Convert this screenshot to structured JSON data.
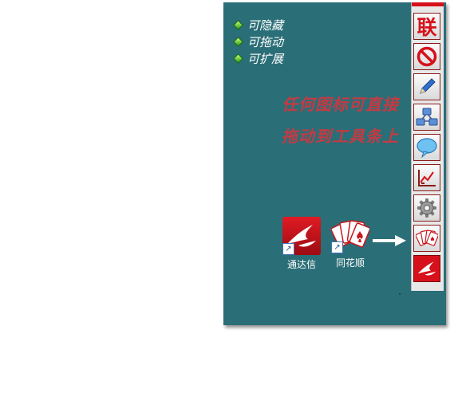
{
  "features": [
    "可隐藏",
    "可拖动",
    "可扩展"
  ],
  "hint_lines": [
    "任何图标可直接",
    "拖动到工具条上"
  ],
  "toolbar": {
    "accent": "#d6111b",
    "buttons": [
      {
        "name": "lian-button",
        "label": "联",
        "icon": "lian-text-icon"
      },
      {
        "name": "forbid-button",
        "icon": "prohibit-icon"
      },
      {
        "name": "edit-button",
        "icon": "pencil-icon"
      },
      {
        "name": "network-button",
        "icon": "network-icon"
      },
      {
        "name": "chat-button",
        "icon": "speech-bubble-icon"
      },
      {
        "name": "chart-button",
        "icon": "chart-icon"
      },
      {
        "name": "settings-button",
        "icon": "gear-icon"
      },
      {
        "name": "tonghuashun-button",
        "icon": "playing-cards-icon"
      },
      {
        "name": "tongdaxin-button",
        "icon": "tongdaxin-logo-icon"
      }
    ]
  },
  "desktop_icons": [
    {
      "label": "通达信",
      "icon": "tongdaxin-logo-icon"
    },
    {
      "label": "同花顺",
      "icon": "playing-cards-icon"
    }
  ]
}
